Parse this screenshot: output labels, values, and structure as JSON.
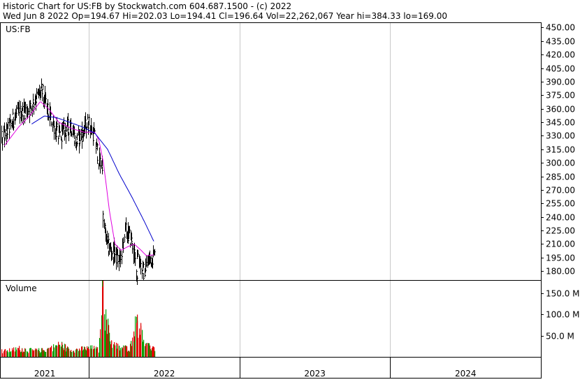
{
  "header": {
    "line1": "Historic Chart for US:FB by Stockwatch.com 604.687.1500 - (c) 2022",
    "line2": "Wed Jun  8 2022   Op=194.67   Hi=202.03   Lo=194.41   Cl=196.64   Vol=22,262,067   Year hi=384.33   lo=169.00"
  },
  "chart_data": [
    {
      "type": "line",
      "panel": "price",
      "title": "US:FB",
      "ylim": [
        170,
        455
      ],
      "yticks": [
        180,
        195,
        210,
        225,
        240,
        255,
        270,
        285,
        300,
        315,
        330,
        345,
        360,
        375,
        390,
        405,
        420,
        435,
        450
      ],
      "yticklabels": [
        "180.00",
        "195.00",
        "210.00",
        "225.00",
        "240.00",
        "255.00",
        "270.00",
        "285.00",
        "300.00",
        "315.00",
        "330.00",
        "345.00",
        "360.00",
        "375.00",
        "390.00",
        "405.00",
        "420.00",
        "435.00",
        "450.00"
      ],
      "xlim": [
        "2021-06-01",
        "2024-12-31"
      ],
      "grid": true,
      "series": [
        {
          "style": "daily-bars",
          "color": "#000000",
          "x": [
            "2021-06-02",
            "2021-06-16",
            "2021-06-30",
            "2021-07-14",
            "2021-07-28",
            "2021-08-11",
            "2021-08-25",
            "2021-09-08",
            "2021-09-22",
            "2021-10-06",
            "2021-10-20",
            "2021-11-03",
            "2021-11-17",
            "2021-12-01",
            "2021-12-15",
            "2021-12-29",
            "2022-01-12",
            "2022-01-26",
            "2022-02-03",
            "2022-02-16",
            "2022-03-02",
            "2022-03-16",
            "2022-03-30",
            "2022-04-13",
            "2022-04-27",
            "2022-04-28",
            "2022-05-11",
            "2022-05-25",
            "2022-06-08"
          ],
          "values": [
            325,
            334,
            348,
            355,
            358,
            360,
            372,
            380,
            358,
            342,
            330,
            336,
            342,
            322,
            333,
            345,
            332,
            300,
            237,
            206,
            200,
            190,
            225,
            215,
            177,
            200,
            178,
            192,
            197
          ]
        },
        {
          "name": "",
          "style": "moving-average-short",
          "color": "#e000e0",
          "x": [
            "2021-06-10",
            "2021-07-15",
            "2021-08-10",
            "2021-09-05",
            "2021-09-25",
            "2021-10-20",
            "2021-11-20",
            "2021-12-20",
            "2022-01-15",
            "2022-01-25",
            "2022-02-05",
            "2022-02-20",
            "2022-03-05",
            "2022-03-20",
            "2022-04-05",
            "2022-04-20",
            "2022-05-05",
            "2022-05-20",
            "2022-06-08"
          ],
          "values": [
            319,
            340,
            352,
            368,
            360,
            345,
            338,
            334,
            334,
            325,
            300,
            245,
            210,
            203,
            207,
            210,
            204,
            197,
            198
          ]
        },
        {
          "name": "",
          "style": "moving-average-long",
          "color": "#0000cc",
          "x": [
            "2021-08-15",
            "2021-09-15",
            "2021-10-15",
            "2021-11-15",
            "2021-12-15",
            "2022-01-15",
            "2022-02-15",
            "2022-03-15",
            "2022-04-15",
            "2022-05-15",
            "2022-06-08"
          ],
          "values": [
            343,
            352,
            350,
            345,
            340,
            333,
            315,
            288,
            262,
            235,
            212
          ]
        }
      ]
    },
    {
      "type": "bar",
      "panel": "volume",
      "title": "Volume",
      "ylim": [
        0,
        180
      ],
      "yticks": [
        50,
        100,
        150
      ],
      "yticklabels": [
        "50.0 M",
        "100.0 M",
        "150.0 M"
      ],
      "unit": "M",
      "colors": {
        "up": "#00a000",
        "down": "#e00000"
      },
      "series": [
        {
          "x": [
            "2021-06-15",
            "2021-07-15",
            "2021-08-15",
            "2021-09-15",
            "2021-10-25",
            "2021-11-15",
            "2021-12-15",
            "2022-01-10",
            "2022-01-25",
            "2022-02-03",
            "2022-02-08",
            "2022-02-25",
            "2022-03-15",
            "2022-04-10",
            "2022-04-28",
            "2022-05-15",
            "2022-06-08"
          ],
          "values": [
            14,
            20,
            15,
            16,
            30,
            15,
            19,
            21,
            16,
            188,
            95,
            32,
            22,
            21,
            100,
            26,
            22
          ]
        }
      ]
    },
    {
      "type": "table",
      "panel": "x-axis",
      "labels": [
        "2021",
        "2022",
        "2023",
        "2024"
      ]
    }
  ]
}
